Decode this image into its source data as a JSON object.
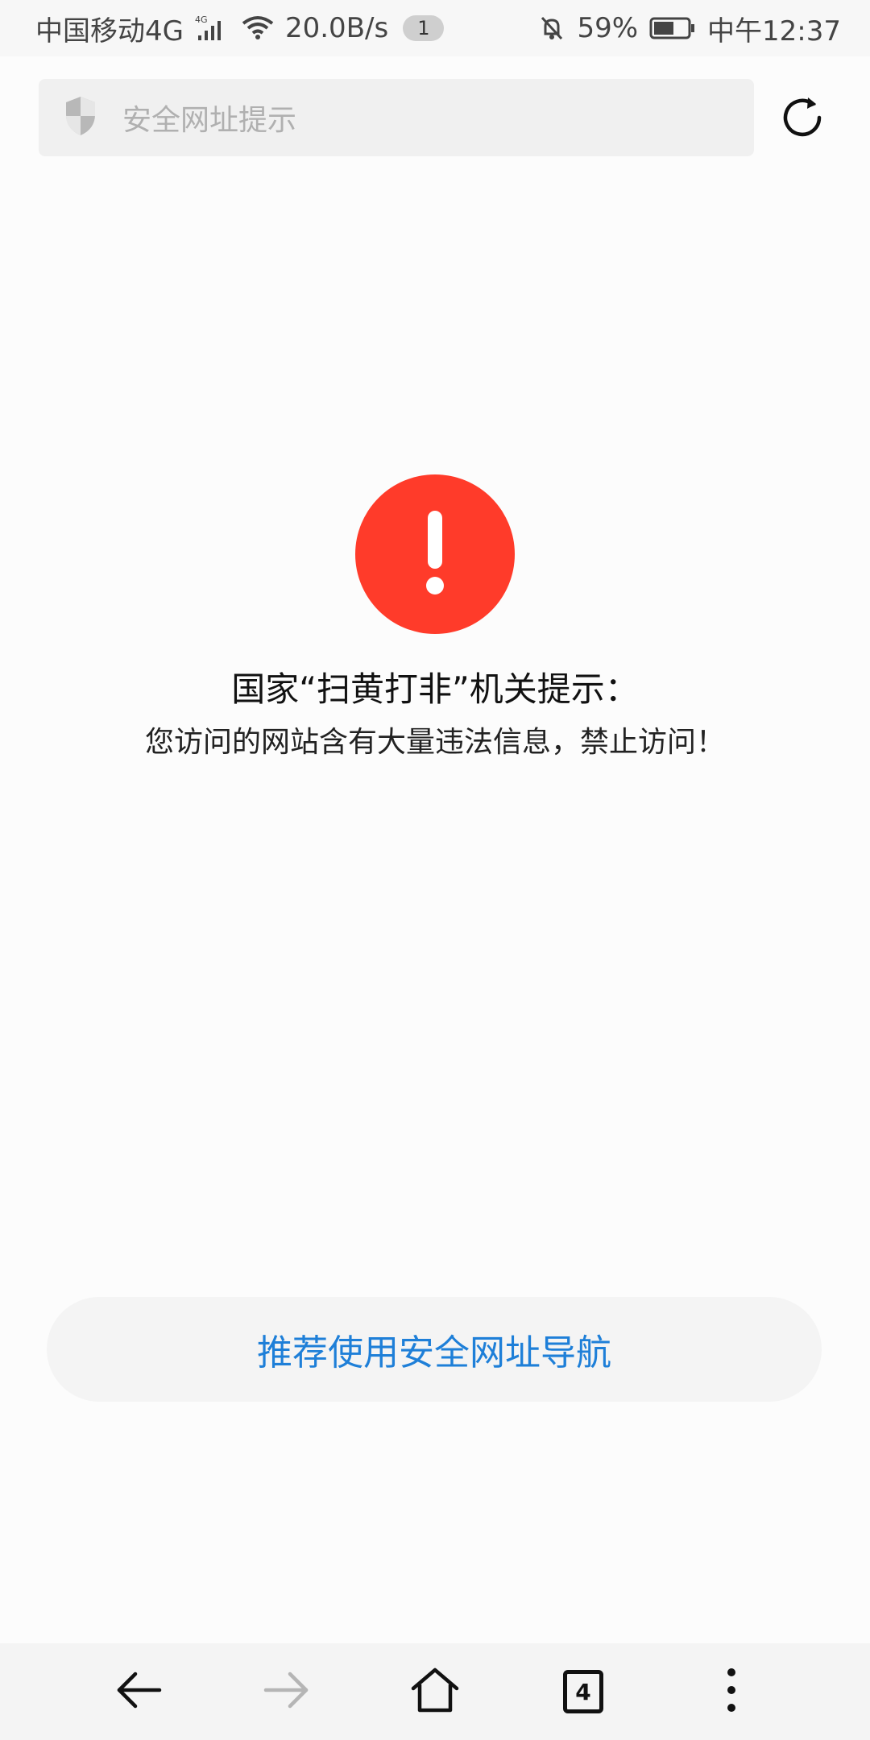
{
  "status_bar": {
    "carrier": "中国移动4G",
    "network_label": "4G",
    "speed": "20.0B/s",
    "notification_count": "1",
    "battery": "59%",
    "time": "中午12:37"
  },
  "address_bar": {
    "placeholder": "安全网址提示",
    "icons": [
      "shield-icon",
      "refresh-icon"
    ]
  },
  "warning": {
    "icon": "exclamation-icon",
    "icon_color": "#ff3b2a",
    "title": "国家“扫黄打非”机关提示：",
    "message": "您访问的网站含有大量违法信息，禁止访问！"
  },
  "safe_nav": {
    "label": "推荐使用安全网址导航",
    "color": "#1e7fd8"
  },
  "bottom_bar": {
    "tabs_count": "4",
    "icons": [
      "back-arrow-icon",
      "forward-arrow-icon",
      "home-icon",
      "tabs-icon",
      "more-menu-icon"
    ]
  }
}
